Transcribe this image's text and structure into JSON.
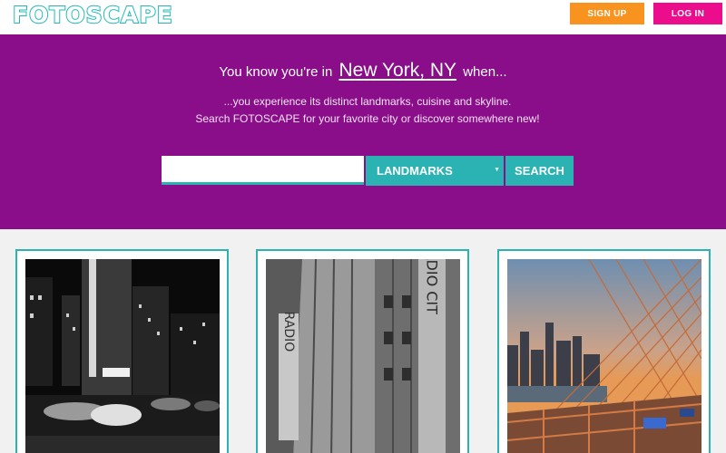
{
  "header": {
    "logo_text": "FOTOSCAPE",
    "signup_label": "SIGN UP",
    "login_label": "LOG IN",
    "colors": {
      "accent": "#2bb3b3",
      "signup": "#f7931e",
      "login": "#ec0d8c"
    }
  },
  "hero": {
    "lead": "You know you're in",
    "city": "New York, NY",
    "tail": "when...",
    "line1": "...you experience its distinct landmarks, cuisine and skyline.",
    "line2": "Search FOTOSCAPE for your favorite city or discover somewhere new!",
    "background": "#8a0d8a"
  },
  "search": {
    "value": "",
    "category": "LANDMARKS",
    "button_label": "SEARCH"
  },
  "gallery": [
    {
      "subject": "radio-city-street-night"
    },
    {
      "subject": "radio-city-facade"
    },
    {
      "subject": "brooklyn-bridge-skyline"
    }
  ]
}
